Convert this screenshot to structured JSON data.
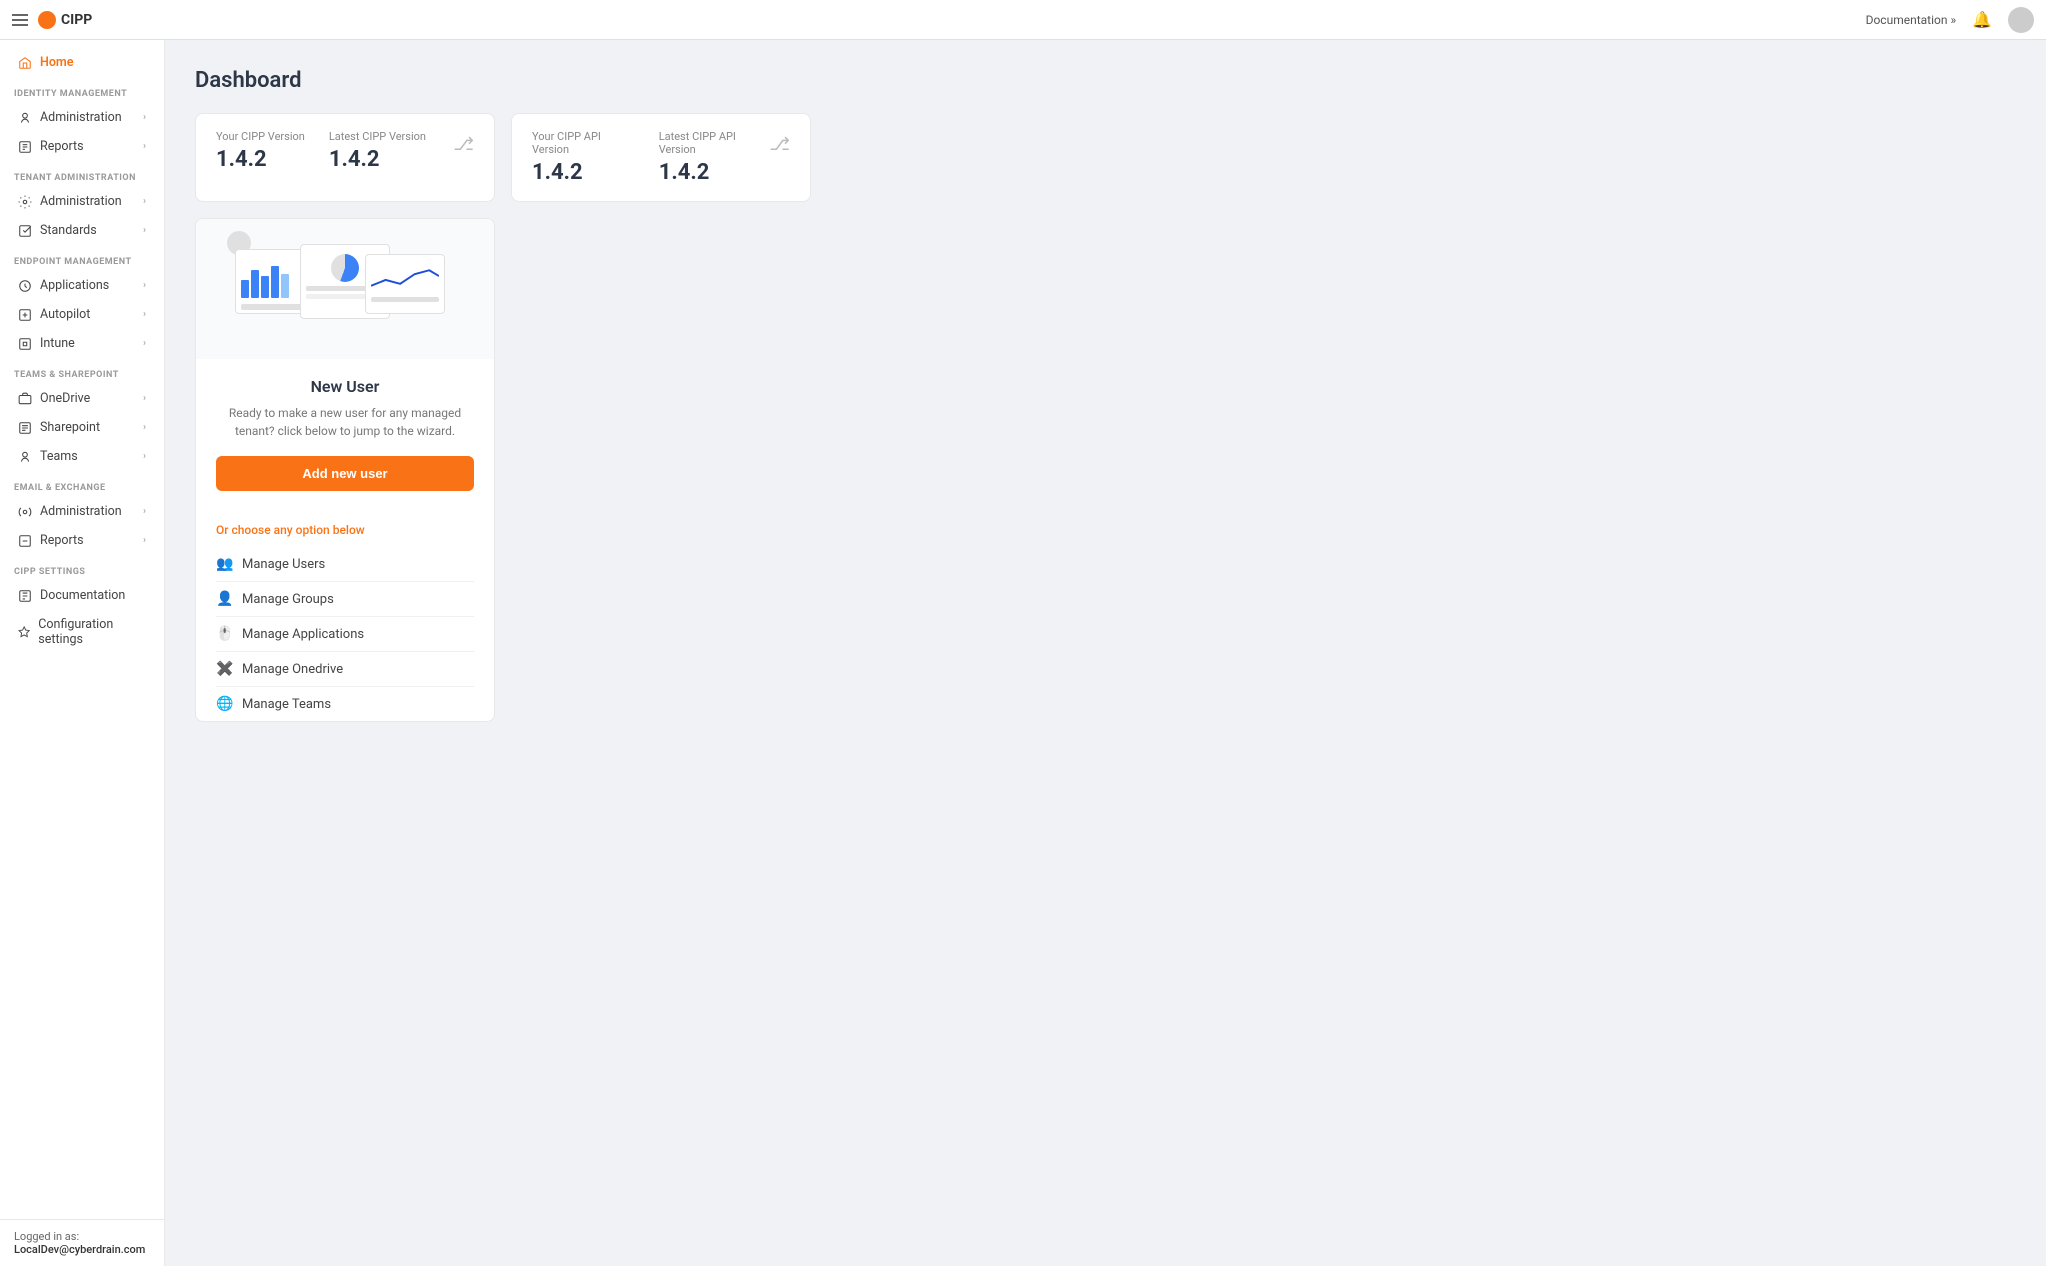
{
  "app": {
    "name": "CIPP",
    "logo_color": "#f97316"
  },
  "topnav": {
    "doc_link": "Documentation »",
    "avatar_label": "User avatar"
  },
  "sidebar": {
    "home_label": "Home",
    "sections": [
      {
        "label": "IDENTITY MANAGEMENT",
        "items": [
          {
            "id": "identity-admin",
            "label": "Administration",
            "has_chevron": true
          },
          {
            "id": "identity-reports",
            "label": "Reports",
            "has_chevron": true
          }
        ]
      },
      {
        "label": "TENANT ADMINISTRATION",
        "items": [
          {
            "id": "tenant-admin",
            "label": "Administration",
            "has_chevron": true
          },
          {
            "id": "tenant-standards",
            "label": "Standards",
            "has_chevron": true
          }
        ]
      },
      {
        "label": "ENDPOINT MANAGEMENT",
        "items": [
          {
            "id": "endpoint-apps",
            "label": "Applications",
            "has_chevron": true
          },
          {
            "id": "endpoint-autopilot",
            "label": "Autopilot",
            "has_chevron": true
          },
          {
            "id": "endpoint-intune",
            "label": "Intune",
            "has_chevron": true
          }
        ]
      },
      {
        "label": "TEAMS & SHAREPOINT",
        "items": [
          {
            "id": "ts-onedrive",
            "label": "OneDrive",
            "has_chevron": true
          },
          {
            "id": "ts-sharepoint",
            "label": "Sharepoint",
            "has_chevron": true
          },
          {
            "id": "ts-teams",
            "label": "Teams",
            "has_chevron": true
          }
        ]
      },
      {
        "label": "EMAIL & EXCHANGE",
        "items": [
          {
            "id": "email-admin",
            "label": "Administration",
            "has_chevron": true
          },
          {
            "id": "email-reports",
            "label": "Reports",
            "has_chevron": true
          }
        ]
      },
      {
        "label": "CIPP SETTINGS",
        "items": [
          {
            "id": "cipp-docs",
            "label": "Documentation",
            "has_chevron": false
          },
          {
            "id": "cipp-config",
            "label": "Configuration settings",
            "has_chevron": false
          }
        ]
      }
    ],
    "footer": {
      "logged_in_label": "Logged in as:",
      "user_email": "LocalDev@cyberdrain.com"
    }
  },
  "main": {
    "page_title": "Dashboard",
    "version_card_1": {
      "your_label": "Your CIPP Version",
      "latest_label": "Latest CIPP Version",
      "your_version": "1.4.2",
      "latest_version": "1.4.2"
    },
    "version_card_2": {
      "your_label": "Your CIPP API Version",
      "latest_label": "Latest CIPP API Version",
      "your_version": "1.4.2",
      "latest_version": "1.4.2"
    },
    "new_user_card": {
      "title": "New User",
      "description": "Ready to make a new user for any managed tenant? click below to jump to the wizard.",
      "button_label": "Add new user",
      "options_label": "Or choose any option below",
      "options": [
        {
          "id": "manage-users",
          "label": "Manage Users",
          "icon": "👥"
        },
        {
          "id": "manage-groups",
          "label": "Manage Groups",
          "icon": "👤"
        },
        {
          "id": "manage-applications",
          "label": "Manage Applications",
          "icon": "🖱️"
        },
        {
          "id": "manage-onedrive",
          "label": "Manage Onedrive",
          "icon": "✖️"
        },
        {
          "id": "manage-teams",
          "label": "Manage Teams",
          "icon": "🌐"
        }
      ]
    }
  }
}
